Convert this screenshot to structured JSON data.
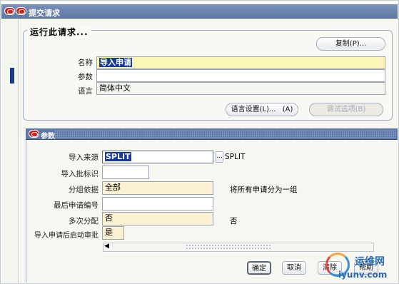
{
  "window": {
    "title": "提交请求"
  },
  "request": {
    "group_label": "运行此请求...",
    "copy_button": "复制(P)...",
    "fields": [
      {
        "label": "名称",
        "value": "导入申请"
      },
      {
        "label": "参数",
        "value": ""
      },
      {
        "label": "语言",
        "value": "简体中文"
      }
    ],
    "language_settings_button": "语言设置(L)...",
    "language_settings_shortcut": "(A)",
    "debug_options_button": "调试选项(B)"
  },
  "params": {
    "title": "参数",
    "rows": [
      {
        "label": "导入来源",
        "value": "SPLIT",
        "desc": "SPLIT"
      },
      {
        "label": "导入批标识",
        "value": "",
        "desc": ""
      },
      {
        "label": "分组依据",
        "value": "全部",
        "desc": "将所有申请分为一组"
      },
      {
        "label": "最后申请编号",
        "value": "",
        "desc": ""
      },
      {
        "label": "多次分配",
        "value": "否",
        "desc": "否"
      },
      {
        "label": "导入申请后启动审批",
        "value": "是",
        "desc": ""
      }
    ],
    "ok_button": "确定",
    "cancel_button": "取消",
    "clear_button": "清除",
    "help_button": "帮助"
  },
  "watermark": {
    "line1": "运维网",
    "line2": "iyunv.com"
  },
  "colors": {
    "titlebar": "#5f7aa5",
    "selection": "#173a9b",
    "required": "#fbf5b8",
    "optional": "#fbf0d2"
  }
}
